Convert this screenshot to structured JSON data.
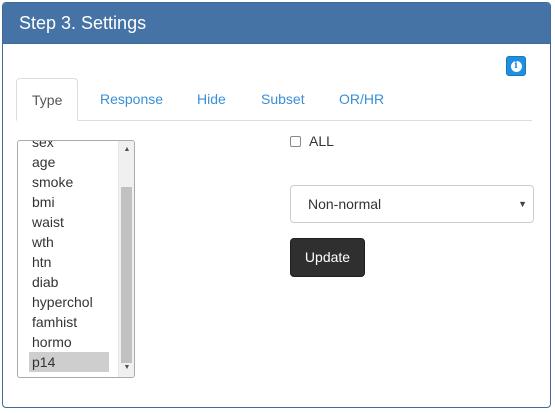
{
  "panel": {
    "title": "Step 3. Settings"
  },
  "info_button": {
    "icon": "info-icon"
  },
  "tabs": [
    {
      "label": "Type",
      "active": true
    },
    {
      "label": "Response",
      "active": false
    },
    {
      "label": "Hide",
      "active": false
    },
    {
      "label": "Subset",
      "active": false
    },
    {
      "label": "OR/HR",
      "active": false
    }
  ],
  "variable_list": {
    "items": [
      "sex",
      "age",
      "smoke",
      "bmi",
      "waist",
      "wth",
      "htn",
      "diab",
      "hyperchol",
      "famhist",
      "hormo",
      "p14"
    ],
    "selected": "p14"
  },
  "all_checkbox": {
    "label": "ALL",
    "checked": false
  },
  "type_select": {
    "value": "Non-normal"
  },
  "update_button": {
    "label": "Update"
  },
  "colors": {
    "header": "#4673a5",
    "link": "#3a8fd6",
    "info": "#1f8fe0",
    "update": "#2f2f2f"
  }
}
